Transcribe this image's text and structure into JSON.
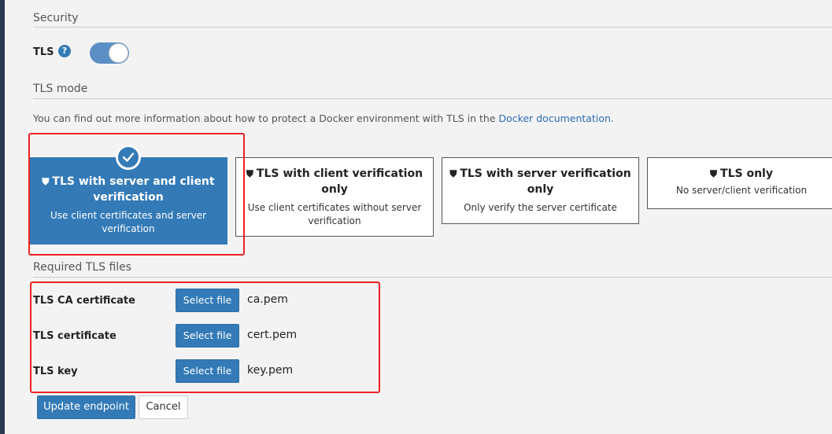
{
  "security": {
    "section_title": "Security",
    "tls_label": "TLS",
    "help_icon_glyph": "?",
    "tls_enabled": true
  },
  "tls_mode": {
    "section_title": "TLS mode",
    "info_prefix": "You can find out more information about how to protect a Docker environment with TLS in the ",
    "info_link": "Docker documentation",
    "info_suffix": ".",
    "options": [
      {
        "title": "TLS with server and client verification",
        "description": "Use client certificates and server verification",
        "selected": true
      },
      {
        "title": "TLS with client verification only",
        "description": "Use client certificates without server verification",
        "selected": false
      },
      {
        "title": "TLS with server verification only",
        "description": "Only verify the server certificate",
        "selected": false
      },
      {
        "title": "TLS only",
        "description": "No server/client verification",
        "selected": false
      }
    ]
  },
  "required_files": {
    "section_title": "Required TLS files",
    "select_file_label": "Select file",
    "files": [
      {
        "label": "TLS CA certificate",
        "filename": "ca.pem"
      },
      {
        "label": "TLS certificate",
        "filename": "cert.pem"
      },
      {
        "label": "TLS key",
        "filename": "key.pem"
      }
    ]
  },
  "actions": {
    "update_label": "Update endpoint",
    "cancel_label": "Cancel"
  },
  "colors": {
    "primary": "#337ab7",
    "highlight_frame": "#e22222",
    "sidebar": "#2b3a4e"
  },
  "icons": {
    "shield": "shield-icon",
    "check": "check-icon",
    "help": "question-circle-icon"
  }
}
